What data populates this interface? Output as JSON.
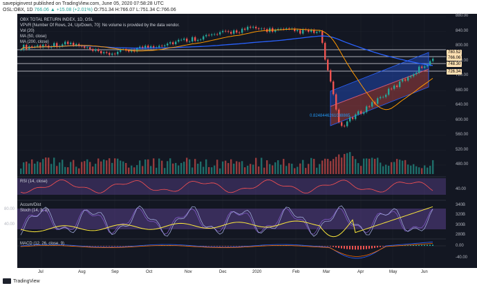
{
  "header": {
    "publisher": "savepiginvest",
    "published_text": "published on TradingView.com, June 05, 2020 07:58:28 UTC"
  },
  "symbol_line": {
    "symbol": "OSL:OBX, 1D",
    "last": "766.06",
    "change": "▲ +15.08 (+2.01%)",
    "ohlc": "O:751.34 H:766.07 L:751.34 C:766.06"
  },
  "legend": {
    "title": "OBX TOTAL RETURN INDEX, 1D, OSL",
    "vpvr": "VPVR [Number Of Rows, 24, Up/Down, 70]: No volume is provided by the data vendor.",
    "vol": "Vol (20)",
    "ma50": "MA (50, close)",
    "ma200": "MA (200, close)",
    "fib_label": "0.8248446261038865",
    "rsi": "RSI (14, close)",
    "accdist": "Accum/Dist",
    "stoch": "Stoch (14, 3, 3)",
    "macd": "MACD (12, 26, close, 9)"
  },
  "price_axis": {
    "ticks": [
      "880.00",
      "840.00",
      "800.00",
      "760.00",
      "720.00",
      "680.00",
      "640.00",
      "600.00",
      "560.00",
      "520.00",
      "480.00"
    ],
    "tags": [
      {
        "text": "780.52",
        "color": "#ffe0b2"
      },
      {
        "text": "766.06",
        "color": "#ffe0b2"
      },
      {
        "text": "748.30",
        "color": "#ffe0b2"
      },
      {
        "text": "726.34",
        "color": "#ffe0b2"
      }
    ]
  },
  "rsi_axis": {
    "ticks": [
      "40.00"
    ]
  },
  "stoch_axis": {
    "left_ticks": [
      "80.00",
      "40.00"
    ],
    "right_ticks": [
      "340B",
      "320B",
      "300B",
      "280B"
    ]
  },
  "macd_axis": {
    "ticks": [
      "0.00",
      "-40.00"
    ]
  },
  "x_axis": {
    "labels": [
      "Jul",
      "Aug",
      "Sep",
      "Oct",
      "Nov",
      "Dec",
      "2020",
      "Feb",
      "Mar",
      "Apr",
      "May",
      "Jun"
    ]
  },
  "footer": {
    "brand": "TradingView"
  },
  "colors": {
    "up": "#26a69a",
    "down": "#ef5350",
    "bg": "#131722",
    "ma200": "#2962ff",
    "ma50": "#ff9800",
    "channel_up": "#2962ff",
    "channel_down": "#ef5350",
    "rsi": "#ff5252",
    "stoch_k": "#ffeb3b",
    "stoch_d": "#7e57c2"
  }
}
